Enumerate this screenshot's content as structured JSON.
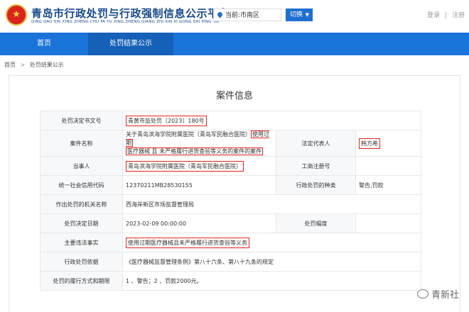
{
  "header": {
    "title": "青岛市行政处罚与行政强制信息公示平台",
    "pinyin": "QING DAO SHI XING ZHENG CHU FA YU XING ZHENG QIANG ZHI XIN XI GONG SHI PING TAI",
    "region": "当前:市南区",
    "switch_label": "切换",
    "login": "登录",
    "register": "注册"
  },
  "nav": {
    "items": [
      "首页",
      "处罚结果公示"
    ]
  },
  "breadcrumb": [
    "首页",
    "处罚结果公示"
  ],
  "panel_title": "案件信息",
  "rows": [
    {
      "label1": "处罚决定书文号",
      "value1": "青黄市监处罚〔2023〕180号"
    },
    {
      "label1": "案件名称",
      "value1a": "关于青岛滨海学院附属医院（青岛军民融合医院）",
      "value1b": "使用过期",
      "value1c": "医疗器械 且 未严格履行进货查验等义务的案件的案件",
      "label2": "法定代表人",
      "value2": "韩方希"
    },
    {
      "label1": "当事人",
      "value1": "青岛滨海学院附属医院（青岛军民融合医院）",
      "label2": "工商注册号",
      "value2": ""
    },
    {
      "label1": "统一社会信用代码",
      "value1": "12370211MB28530155",
      "label2": "行政处罚的种类",
      "value2": "警告,罚款"
    },
    {
      "label1": "作出处罚的机关名称",
      "value1": "西海岸新区市场监督管理局"
    },
    {
      "label1": "处罚决定日期",
      "value1": "2023-02-09 00:00:00",
      "label2": "处罚幅度",
      "value2": ""
    },
    {
      "label1": "主要违法事实",
      "value1": "使用过期医疗器械且未严格履行进货查验等义务"
    },
    {
      "label1": "行政处罚依据",
      "value1": "《医疗器械监督管理条例》第八十六条、第八十九条的规定"
    },
    {
      "label1": "处罚的履行方式和期限",
      "value1": "1 、警告；2 、罚款2000元。"
    }
  ],
  "watermark": "青新社",
  "colors": {
    "nav": "#1a73d9",
    "nav_active": "#1560b8",
    "highlight": "#e2231a",
    "title": "#1a4a8a"
  }
}
